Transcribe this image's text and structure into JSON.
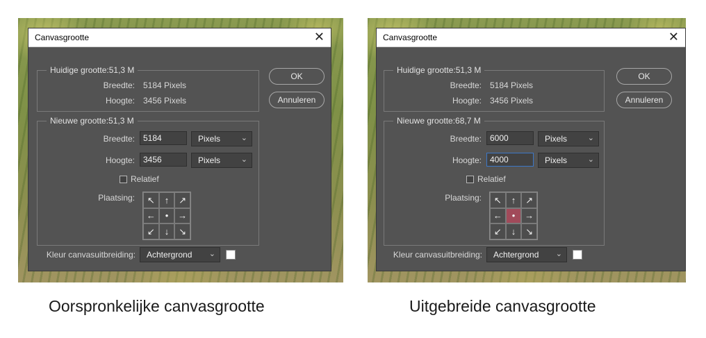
{
  "left": {
    "dialog_title": "Canvasgrootte",
    "close_symbol": "✕",
    "current": {
      "legend": "Huidige grootte:51,3 M",
      "width_label": "Breedte:",
      "width_value": "5184 Pixels",
      "height_label": "Hoogte:",
      "height_value": "3456 Pixels"
    },
    "new": {
      "legend": "Nieuwe grootte:51,3 M",
      "width_label": "Breedte:",
      "width_input": "5184",
      "width_unit": "Pixels",
      "height_label": "Hoogte:",
      "height_input": "3456",
      "height_unit": "Pixels",
      "relative_label": "Relatief",
      "relative_checked": false,
      "anchor_label": "Plaatsing:"
    },
    "anchor_glyphs": [
      "↖",
      "↑",
      "↗",
      "←",
      "•",
      "→",
      "↙",
      "↓",
      "↘"
    ],
    "anchor_highlighted": false,
    "extension_label": "Kleur canvasuitbreiding:",
    "extension_value": "Achtergrond",
    "extension_color": "#ffffff",
    "ok_label": "OK",
    "cancel_label": "Annuleren"
  },
  "right": {
    "dialog_title": "Canvasgrootte",
    "close_symbol": "✕",
    "current": {
      "legend": "Huidige grootte:51,3 M",
      "width_label": "Breedte:",
      "width_value": "5184 Pixels",
      "height_label": "Hoogte:",
      "height_value": "3456 Pixels"
    },
    "new": {
      "legend": "Nieuwe grootte:68,7 M",
      "width_label": "Breedte:",
      "width_input": "6000",
      "width_unit": "Pixels",
      "height_label": "Hoogte:",
      "height_input": "4000",
      "height_unit": "Pixels",
      "relative_label": "Relatief",
      "relative_checked": false,
      "anchor_label": "Plaatsing:"
    },
    "anchor_glyphs": [
      "↖",
      "↑",
      "↗",
      "←",
      "•",
      "→",
      "↙",
      "↓",
      "↘"
    ],
    "anchor_highlighted": true,
    "highlight_color": "#a14a5a",
    "extension_label": "Kleur canvasuitbreiding:",
    "extension_value": "Achtergrond",
    "extension_color": "#ffffff",
    "ok_label": "OK",
    "cancel_label": "Annuleren"
  },
  "captions": {
    "left": "Oorspronkelijke canvasgrootte",
    "right": "Uitgebreide canvasgrootte"
  },
  "icons": {
    "close": "close-icon",
    "dropdown": "chevron-down-icon",
    "anchor": "arrow-icons"
  }
}
